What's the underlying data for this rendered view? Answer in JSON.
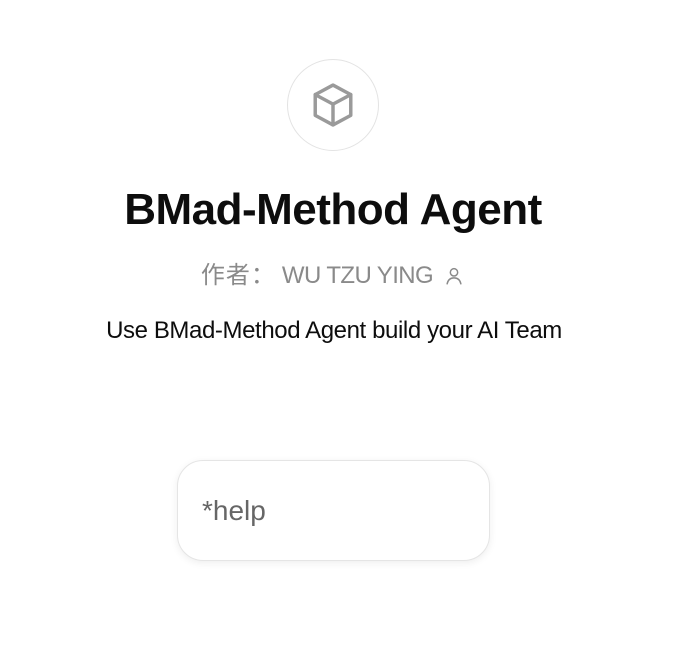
{
  "gpt": {
    "icon": "cube-icon",
    "title": "BMad-Method Agent",
    "author_prefix": "作者：",
    "author_name": "WU TZU YING",
    "author_icon": "person-icon",
    "description": "Use BMad-Method Agent build your AI Team"
  },
  "conversation_starters": [
    {
      "label": "*help"
    }
  ],
  "colors": {
    "title": "#0d0d0d",
    "muted": "#8a8a8a",
    "border": "#e5e5e5"
  }
}
